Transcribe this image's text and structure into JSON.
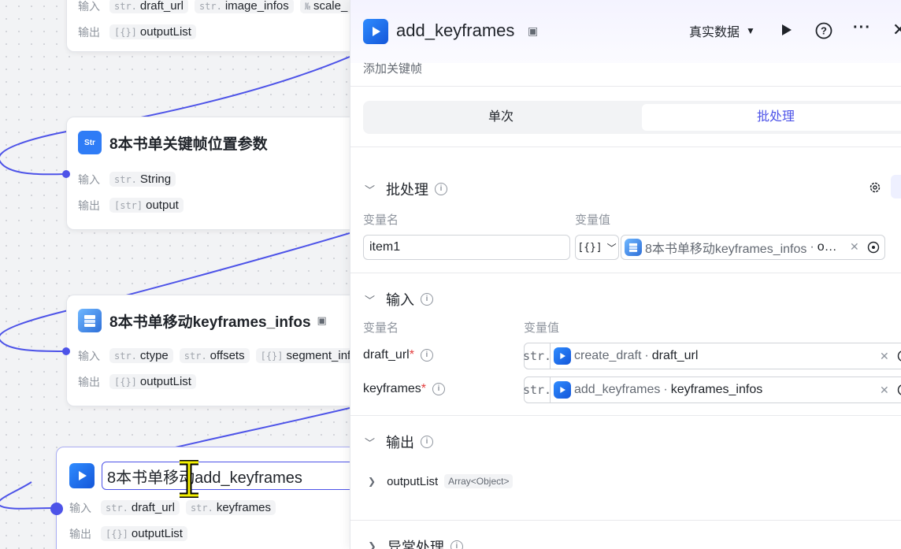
{
  "canvas": {
    "nodes": [
      {
        "title": "",
        "inputs_label": "输入",
        "outputs_label": "输出",
        "inputs": [
          {
            "type": "str.",
            "name": "draft_url"
          },
          {
            "type": "str.",
            "name": "image_infos"
          },
          {
            "type": "№",
            "name": "scale_"
          }
        ],
        "outputs": [
          {
            "type": "[{}]",
            "name": "outputList"
          }
        ]
      },
      {
        "title": "8本书单关键帧位置参数",
        "icon": "str-icon",
        "inputs_label": "输入",
        "outputs_label": "输出",
        "inputs": [
          {
            "type": "str.",
            "name": "String"
          }
        ],
        "outputs": [
          {
            "type": "[str]",
            "name": "output"
          }
        ]
      },
      {
        "title": "8本书单移动keyframes_infos",
        "icon": "stack-icon",
        "inputs_label": "输入",
        "outputs_label": "输出",
        "inputs": [
          {
            "type": "str.",
            "name": "ctype"
          },
          {
            "type": "str.",
            "name": "offsets"
          },
          {
            "type": "[{}]",
            "name": "segment_infos"
          }
        ],
        "outputs": [
          {
            "type": "[{}]",
            "name": "outputList"
          }
        ]
      },
      {
        "title": "8本书单移动add_keyframes",
        "icon": "play-icon",
        "inputs_label": "输入",
        "outputs_label": "输出",
        "inputs": [
          {
            "type": "str.",
            "name": "draft_url"
          },
          {
            "type": "str.",
            "name": "keyframes"
          }
        ],
        "outputs": [
          {
            "type": "[{}]",
            "name": "outputList"
          }
        ]
      }
    ]
  },
  "panel": {
    "title": "add_keyframes",
    "description": "添加关键帧",
    "data_mode": "真实数据",
    "tabs": [
      {
        "label": "单次",
        "active": false
      },
      {
        "label": "批处理",
        "active": true
      }
    ],
    "batch": {
      "section_title": "批处理",
      "col_name": "变量名",
      "col_value": "变量值",
      "item_name": "item1",
      "item_type": "[{}]",
      "item_ref_node": "8本书单移动keyframes_infos",
      "item_ref_sep": "·",
      "item_ref_field": "o…"
    },
    "inputs": {
      "section_title": "输入",
      "col_name": "变量名",
      "col_value": "变量值",
      "fields": [
        {
          "name": "draft_url",
          "required_mark": "*",
          "type": "str.",
          "ref_node": "create_draft",
          "sep": "·",
          "ref_field": "draft_url"
        },
        {
          "name": "keyframes",
          "required_mark": "*",
          "type": "str.",
          "ref_node": "add_keyframes",
          "sep": "·",
          "ref_field": "keyframes_infos"
        }
      ]
    },
    "outputs": {
      "section_title": "输出",
      "item_name": "outputList",
      "item_type": "Array<Object>"
    },
    "error_section_title": "异常处理"
  },
  "colors": {
    "accent": "#4d53e8",
    "active_tab_text": "#4d53e8",
    "node_icon_blue": "#2f7cf6"
  }
}
